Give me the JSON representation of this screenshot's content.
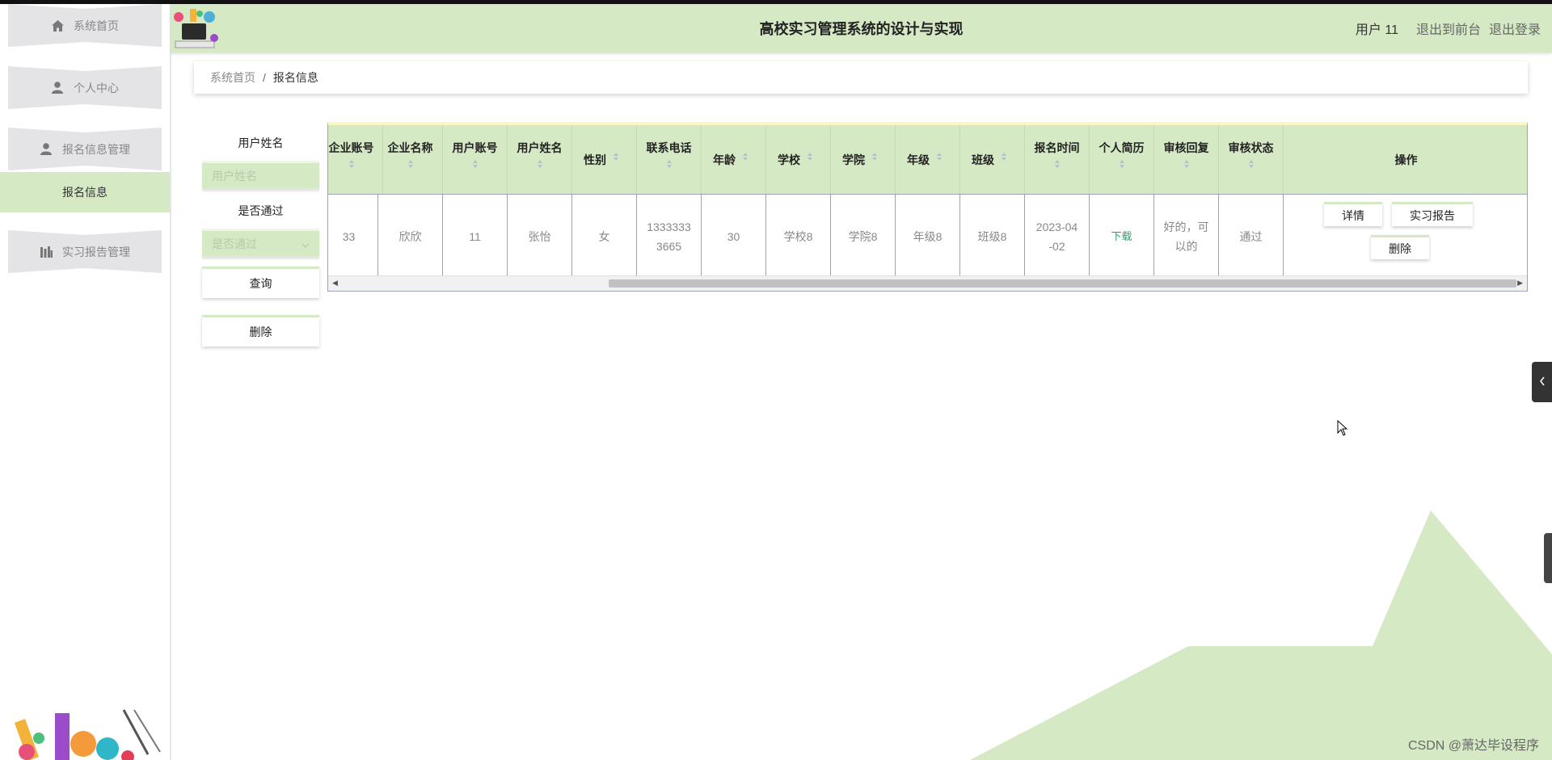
{
  "sidebar": {
    "items": [
      {
        "label": "系统首页",
        "icon": "home-icon"
      },
      {
        "label": "个人中心",
        "icon": "user-icon"
      },
      {
        "label": "报名信息管理",
        "icon": "user-icon"
      },
      {
        "label": "实习报告管理",
        "icon": "chart-icon"
      }
    ],
    "sub_active": "报名信息"
  },
  "header": {
    "title": "高校实习管理系统的设计与实现",
    "user": "用户 11",
    "links": [
      "退出到前台",
      "退出登录"
    ],
    "accent": "#d5e9c5"
  },
  "breadcrumb": {
    "home": "系统首页",
    "separator": "/",
    "current": "报名信息"
  },
  "search": {
    "name_label": "用户姓名",
    "name_placeholder": "用户姓名",
    "pass_label": "是否通过",
    "pass_placeholder": "是否通过",
    "query_button": "查询",
    "delete_button": "删除"
  },
  "table": {
    "columns": [
      "企业账号",
      "企业名称",
      "用户账号",
      "用户姓名",
      "性别",
      "联系电话",
      "年龄",
      "学校",
      "学院",
      "年级",
      "班级",
      "报名时间",
      "个人简历",
      "审核回复",
      "审核状态",
      "操作"
    ],
    "rows": [
      {
        "cells": [
          "33",
          "欣欣",
          "11",
          "张怡",
          "女",
          "1333333\n3665",
          "30",
          "学校8",
          "学院8",
          "年级8",
          "班级8",
          "2023-04\n-02",
          "下载",
          "好的，可\n以的",
          "通过"
        ],
        "actions": [
          "详情",
          "实习报告",
          "删除"
        ]
      }
    ]
  },
  "watermark": "CSDN @萧达毕设程序"
}
